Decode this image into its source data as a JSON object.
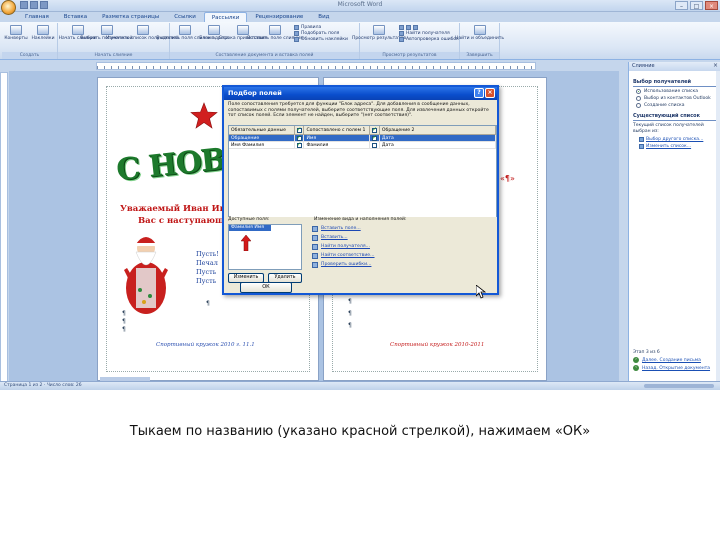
{
  "window": {
    "title": "Microsoft Word"
  },
  "ribbon": {
    "tabs": [
      {
        "label": "Главная",
        "active": false
      },
      {
        "label": "Вставка",
        "active": false
      },
      {
        "label": "Разметка страницы",
        "active": false
      },
      {
        "label": "Ссылки",
        "active": false
      },
      {
        "label": "Рассылки",
        "active": true
      },
      {
        "label": "Рецензирование",
        "active": false
      },
      {
        "label": "Вид",
        "active": false
      }
    ],
    "groups": [
      {
        "name": "Создать",
        "buttons": [
          "Конверты",
          "Наклейки"
        ]
      },
      {
        "name": "Начать слияние",
        "buttons": [
          "Начать слияние",
          "Выбрать получателей",
          "Изменить список получателей"
        ]
      },
      {
        "name": "Составление документа и вставка полей",
        "buttons": [
          "Выделить поля слияния",
          "Блок адреса",
          "Строка приветствия",
          "Вставить поле слияния"
        ],
        "small": [
          "Правила",
          "Подобрать поля",
          "Обновить наклейки"
        ]
      },
      {
        "name": "Просмотр результатов",
        "buttons": [
          "Просмотр результатов"
        ],
        "small": [
          "Найти получателя",
          "Автопроверка ошибок"
        ]
      },
      {
        "name": "Завершить",
        "buttons": [
          "Найти и объединить"
        ]
      }
    ]
  },
  "document": {
    "headline": "С НОВЫМ",
    "greeting_line1": "Уважаемый Иван Иванов",
    "greeting_line2": "Вас с наступающим",
    "poem": [
      "Пусть!",
      "Печал",
      "Пусть",
      "Пусть"
    ],
    "signature_left": "Спортивный кружок 2010 г. 11.1",
    "signature_right": "Спортивный кружок 2010-2011",
    "field_mark": "«¶»"
  },
  "dialog": {
    "title": "Подбор полей",
    "description": "Поле сопоставления требуется для функции \"Блок адреса\". Для добавления в сообщение данных, сопоставимых с полями получателей, выберите соответствующие поля. Для извлечения данных откройте тот список полей. Если элемент не найден, выберите \"(нет соответствия)\".",
    "columns": [
      "Обязательные данные",
      "Сопоставлено с полем 1",
      "Обращение 2"
    ],
    "rows": [
      {
        "field": "Обращение",
        "checked": true,
        "match": "Имя",
        "checked2": true,
        "match2": "Дата"
      },
      {
        "field": "Имя Фамилия",
        "checked": true,
        "match": "Фамилия",
        "checked2": false,
        "match2": "Дата"
      }
    ],
    "available_label": "Доступные поля:",
    "available_items": [
      "Фамилия Имя"
    ],
    "actions_label": "Изменение вида и наполнения полей:",
    "actions": [
      "Вставить поле...",
      "Вставить...",
      "Найти получателя...",
      "Найти соответствие...",
      "Проверить ошибки..."
    ],
    "buttons": {
      "change": "Изменить",
      "delete": "Удалить",
      "ok": "ОК"
    }
  },
  "taskpane": {
    "title": "Слияние",
    "section1": "Выбор получателей",
    "radios": [
      {
        "label": "Использование списка",
        "selected": true
      },
      {
        "label": "Выбор из контактов Outlook",
        "selected": false
      },
      {
        "label": "Создание списка",
        "selected": false
      }
    ],
    "section2": "Существующий список",
    "text": "Текущий список получателей выбран из:",
    "links": [
      "Выбор другого списка...",
      "Изменить список..."
    ],
    "step_label": "Этап 3 из 6",
    "steps": [
      "Далее. Создание письма",
      "Назад. Открытие документа"
    ]
  },
  "statusbar": {
    "text": "Страница 1 из 2 · Число слов: 26"
  },
  "caption": "Тыкаем по названию (указано красной стрелкой), нажимаем «ОК»"
}
